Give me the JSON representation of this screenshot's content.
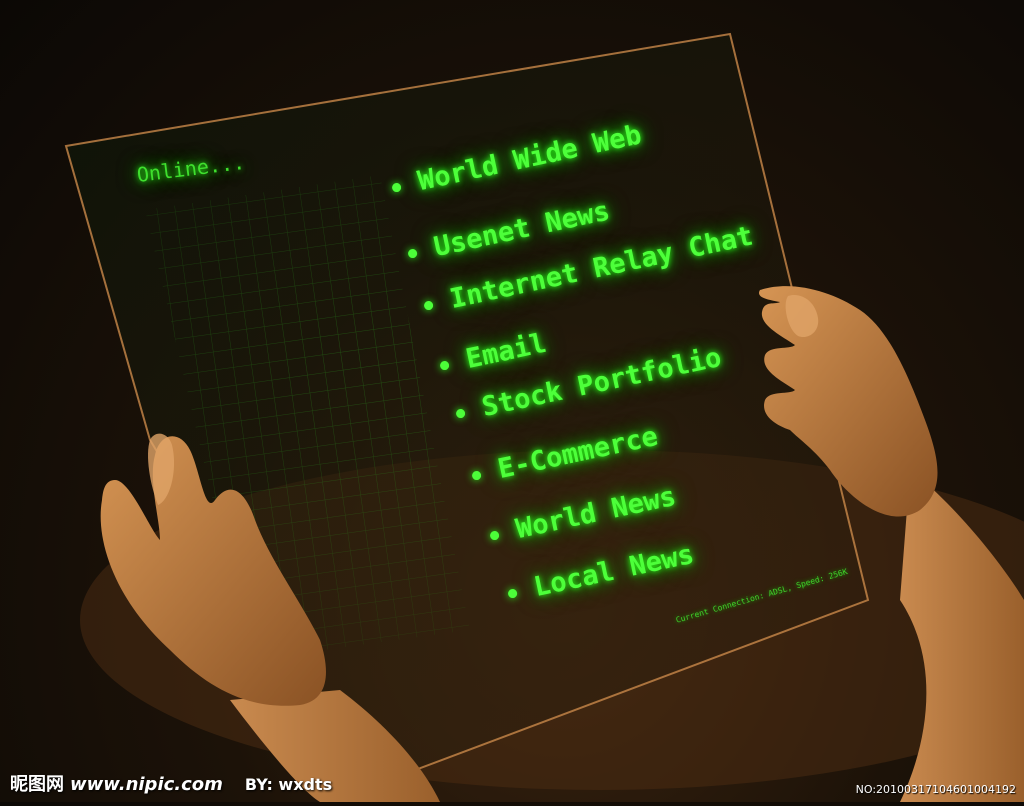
{
  "screen": {
    "online_label": "Online...",
    "menu_items": [
      "World Wide Web",
      "Usenet News",
      "Internet Relay Chat",
      "Email",
      "Stock Portfolio",
      "E-Commerce",
      "World News",
      "Local News"
    ],
    "status_line": "Current Connection: ADSL, Speed: 256K"
  },
  "watermark": {
    "brand": "昵图网",
    "site": "www.nipic.com",
    "author": "BY: wxdts",
    "image_no": "NO:20100317104601004192"
  },
  "colors": {
    "glow_text": "#4dff3a",
    "background": "#1c1208",
    "skin": "#b8743c",
    "panel_edge": "#c9884a"
  }
}
